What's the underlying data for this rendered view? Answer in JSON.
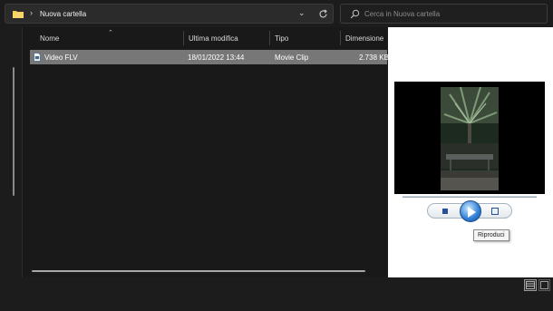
{
  "address": {
    "breadcrumb_separator": "›",
    "folder_name": "Nuova cartella",
    "dropdown_glyph": "⌄"
  },
  "search": {
    "placeholder": "Cerca in Nuova cartella"
  },
  "columns": {
    "name": "Nome",
    "modified": "Ultima modifica",
    "type": "Tipo",
    "size": "Dimensione",
    "sort_glyph": "⌃"
  },
  "files": [
    {
      "name": "Video FLV",
      "modified": "18/01/2022 13:44",
      "type": "Movie Clip",
      "size": "2.738 KB",
      "icon": "video-file-icon",
      "selected": true
    }
  ],
  "preview": {
    "tooltip": "Riproduci",
    "controls": [
      "stop-icon",
      "play-icon",
      "fullscreen-icon"
    ]
  },
  "colors": {
    "selection": "#777777",
    "folder": "#f2c94c",
    "play_button": "#2f7ed6"
  }
}
